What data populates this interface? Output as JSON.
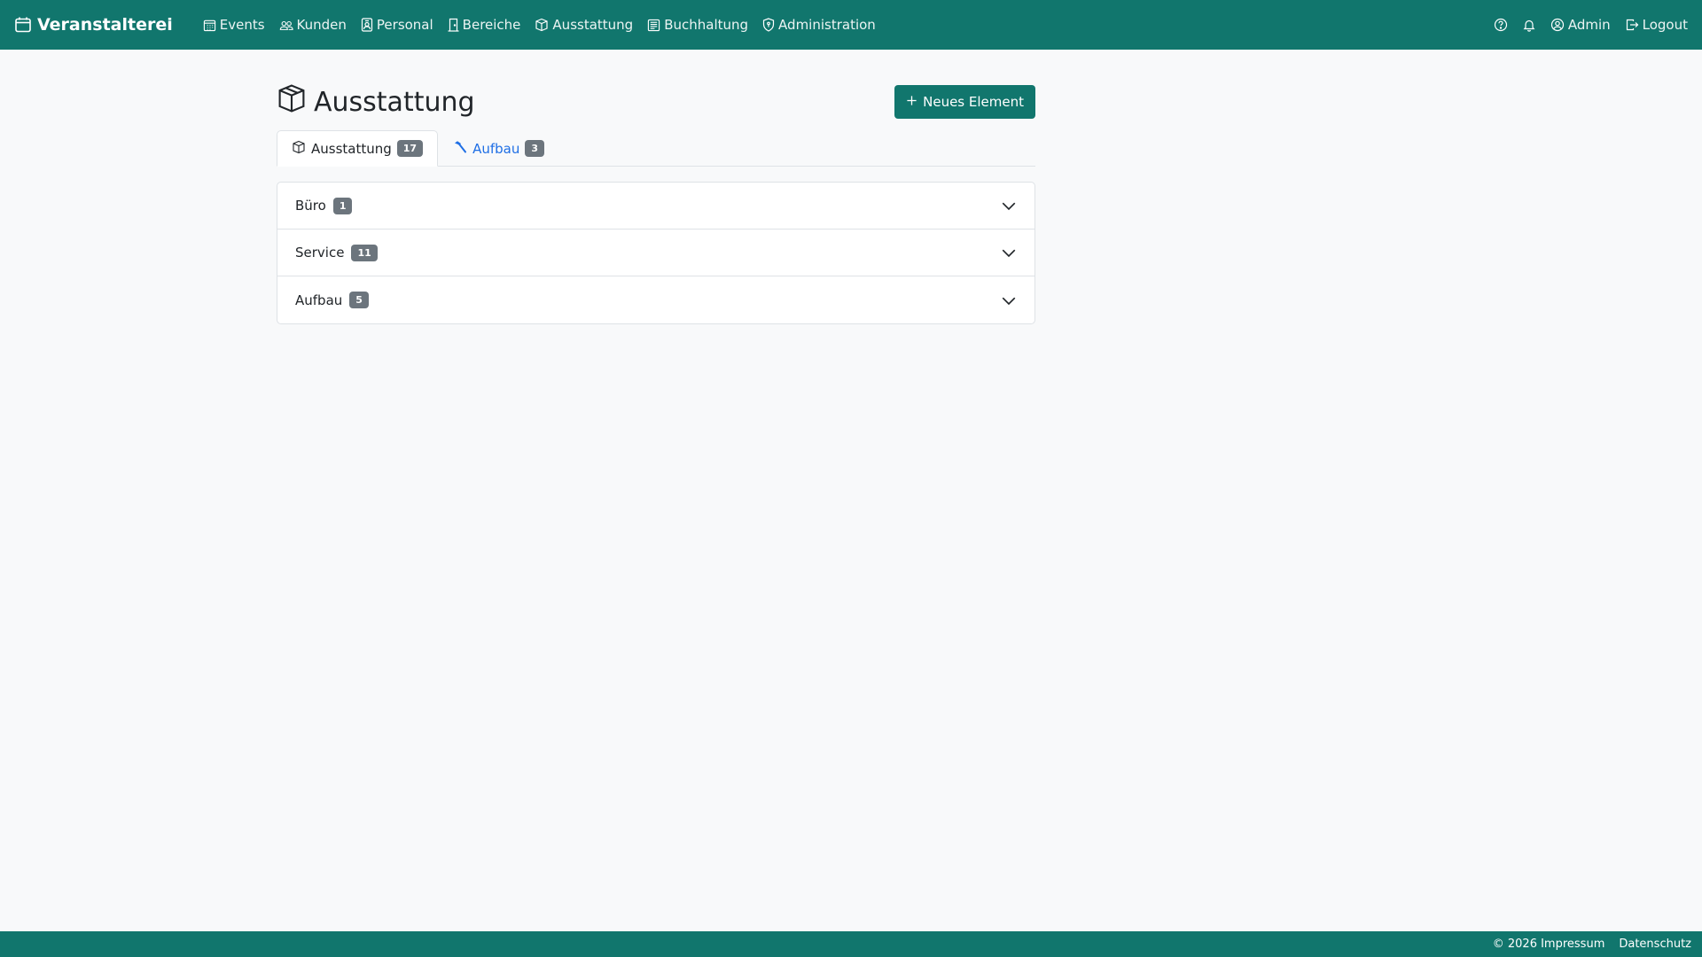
{
  "navbar": {
    "brand": "Veranstalterei",
    "items": [
      {
        "label": "Events",
        "icon": "calendar-grid-icon"
      },
      {
        "label": "Kunden",
        "icon": "people-icon"
      },
      {
        "label": "Personal",
        "icon": "person-badge-icon"
      },
      {
        "label": "Bereiche",
        "icon": "door-icon"
      },
      {
        "label": "Ausstattung",
        "icon": "box-icon"
      },
      {
        "label": "Buchhaltung",
        "icon": "ledger-icon"
      },
      {
        "label": "Administration",
        "icon": "shield-icon"
      }
    ],
    "user": "Admin",
    "logout": "Logout"
  },
  "page": {
    "title": "Ausstattung",
    "new_button": "Neues Element"
  },
  "tabs": [
    {
      "label": "Ausstattung",
      "count": "17",
      "active": true
    },
    {
      "label": "Aufbau",
      "count": "3",
      "active": false
    }
  ],
  "categories": [
    {
      "label": "Büro",
      "count": "1"
    },
    {
      "label": "Service",
      "count": "11"
    },
    {
      "label": "Aufbau",
      "count": "5"
    }
  ],
  "footer": {
    "copyright": "© 2026 Impressum",
    "privacy": "Datenschutz"
  },
  "colors": {
    "brand": "#11766d",
    "link": "#1f6fe5",
    "badge": "#6c757d"
  }
}
